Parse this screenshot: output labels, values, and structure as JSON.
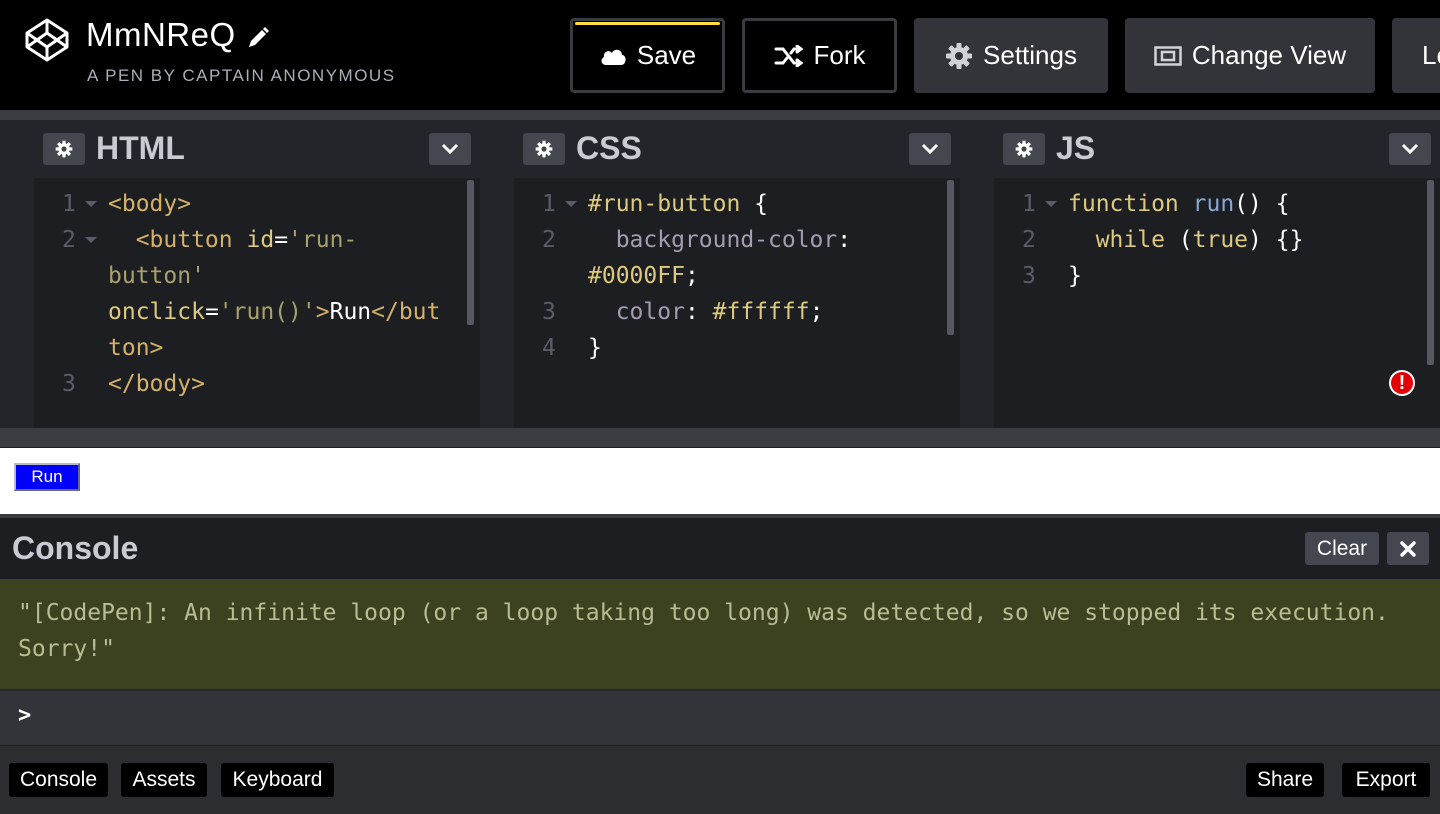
{
  "header": {
    "pen_title": "MmNReQ",
    "subtitle": "A PEN BY CAPTAIN ANONYMOUS",
    "buttons": {
      "save": "Save",
      "fork": "Fork",
      "settings": "Settings",
      "change_view": "Change View",
      "login": "Lo"
    }
  },
  "editors": {
    "html": {
      "title": "HTML",
      "lines": [
        {
          "num": "1",
          "fold": true,
          "segments": [
            [
              "c-tag",
              "<body>"
            ]
          ]
        },
        {
          "num": "2",
          "fold": true,
          "segments": [
            [
              "c-tag",
              "  <button "
            ],
            [
              "c-attr",
              "id"
            ],
            [
              "c-plain",
              "="
            ],
            [
              "c-str",
              "'run-"
            ]
          ]
        },
        {
          "num": "",
          "fold": false,
          "segments": [
            [
              "c-str",
              "button'"
            ]
          ]
        },
        {
          "num": "",
          "fold": false,
          "segments": [
            [
              "c-attr",
              "onclick"
            ],
            [
              "c-plain",
              "="
            ],
            [
              "c-str",
              "'run()'"
            ],
            [
              "c-tag",
              ">"
            ],
            [
              "c-plain",
              "Run"
            ],
            [
              "c-tag",
              "</but"
            ]
          ]
        },
        {
          "num": "",
          "fold": false,
          "segments": [
            [
              "c-tag",
              "ton>"
            ]
          ]
        },
        {
          "num": "3",
          "fold": false,
          "segments": [
            [
              "c-tag",
              "</body>"
            ]
          ]
        }
      ]
    },
    "css": {
      "title": "CSS",
      "lines": [
        {
          "num": "1",
          "fold": true,
          "segments": [
            [
              "c-sel",
              "#run-button "
            ],
            [
              "c-plain",
              "{"
            ]
          ]
        },
        {
          "num": "2",
          "fold": false,
          "segments": [
            [
              "c-prop",
              "  background-color"
            ],
            [
              "c-plain",
              ":"
            ]
          ]
        },
        {
          "num": "",
          "fold": false,
          "segments": [
            [
              "c-val",
              "#0000FF"
            ],
            [
              "c-plain",
              ";"
            ]
          ]
        },
        {
          "num": "3",
          "fold": false,
          "segments": [
            [
              "c-prop",
              "  color"
            ],
            [
              "c-plain",
              ": "
            ],
            [
              "c-val",
              "#ffffff"
            ],
            [
              "c-plain",
              ";"
            ]
          ]
        },
        {
          "num": "4",
          "fold": false,
          "segments": [
            [
              "c-plain",
              "}"
            ]
          ]
        }
      ]
    },
    "js": {
      "title": "JS",
      "lines": [
        {
          "num": "1",
          "fold": true,
          "segments": [
            [
              "c-kw",
              "function "
            ],
            [
              "c-fn",
              "run"
            ],
            [
              "c-plain",
              "() {"
            ]
          ]
        },
        {
          "num": "2",
          "fold": false,
          "segments": [
            [
              "c-kw",
              "  while "
            ],
            [
              "c-plain",
              "("
            ],
            [
              "c-kw",
              "true"
            ],
            [
              "c-plain",
              ") {}"
            ]
          ]
        },
        {
          "num": "3",
          "fold": false,
          "segments": [
            [
              "c-plain",
              "}"
            ]
          ]
        }
      ],
      "error_badge": "!"
    }
  },
  "result": {
    "run_button": "Run"
  },
  "console": {
    "title": "Console",
    "clear": "Clear",
    "message": "\"[CodePen]: An infinite loop (or a loop taking too long) was detected, so we stopped its execution. Sorry!\"",
    "prompt": ">"
  },
  "footer": {
    "console": "Console",
    "assets": "Assets",
    "keyboard": "Keyboard",
    "share": "Share",
    "export": "Export"
  },
  "colors": {
    "accent_yellow": "#ffdd40",
    "error_red": "#e40000",
    "console_message_bg": "#3c4220",
    "run_button_bg": "#0000FF"
  }
}
